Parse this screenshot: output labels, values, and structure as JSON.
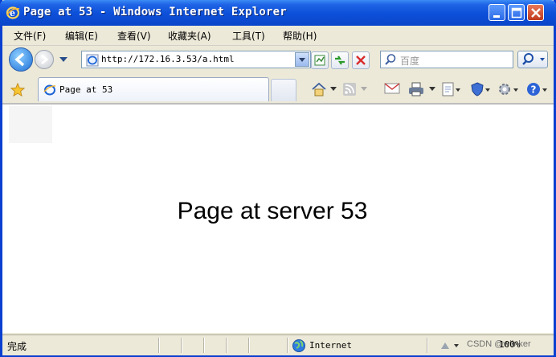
{
  "window": {
    "title": "Page at 53 - Windows Internet Explorer"
  },
  "menu": {
    "items": [
      "文件(F)",
      "编辑(E)",
      "查看(V)",
      "收藏夹(A)",
      "工具(T)",
      "帮助(H)"
    ]
  },
  "address": {
    "url": "http://172.16.3.53/a.html"
  },
  "search": {
    "placeholder": "百度"
  },
  "tabs": [
    {
      "label": "Page at 53"
    }
  ],
  "content": {
    "heading": "Page at server 53"
  },
  "status": {
    "text": "完成",
    "zone": "Internet",
    "zoom": "100%"
  },
  "watermark": {
    "text": "CSDN @wlinker"
  },
  "colors": {
    "titlebar": "#0a45c9",
    "frame": "#0a3fd0",
    "chrome": "#ece9d8",
    "close_button": "#c0391c"
  },
  "icons": [
    "ie-logo-icon",
    "minimize-icon",
    "maximize-icon",
    "close-icon",
    "back-icon",
    "forward-icon",
    "recent-pages-icon",
    "page-icon",
    "dropdown-icon",
    "compatibility-icon",
    "refresh-icon",
    "stop-icon",
    "search-icon",
    "favorites-star-icon",
    "home-icon",
    "feeds-icon",
    "mail-icon",
    "print-icon",
    "page-menu-icon",
    "safety-icon",
    "tools-icon",
    "help-icon",
    "globe-icon",
    "zoom-icon"
  ]
}
